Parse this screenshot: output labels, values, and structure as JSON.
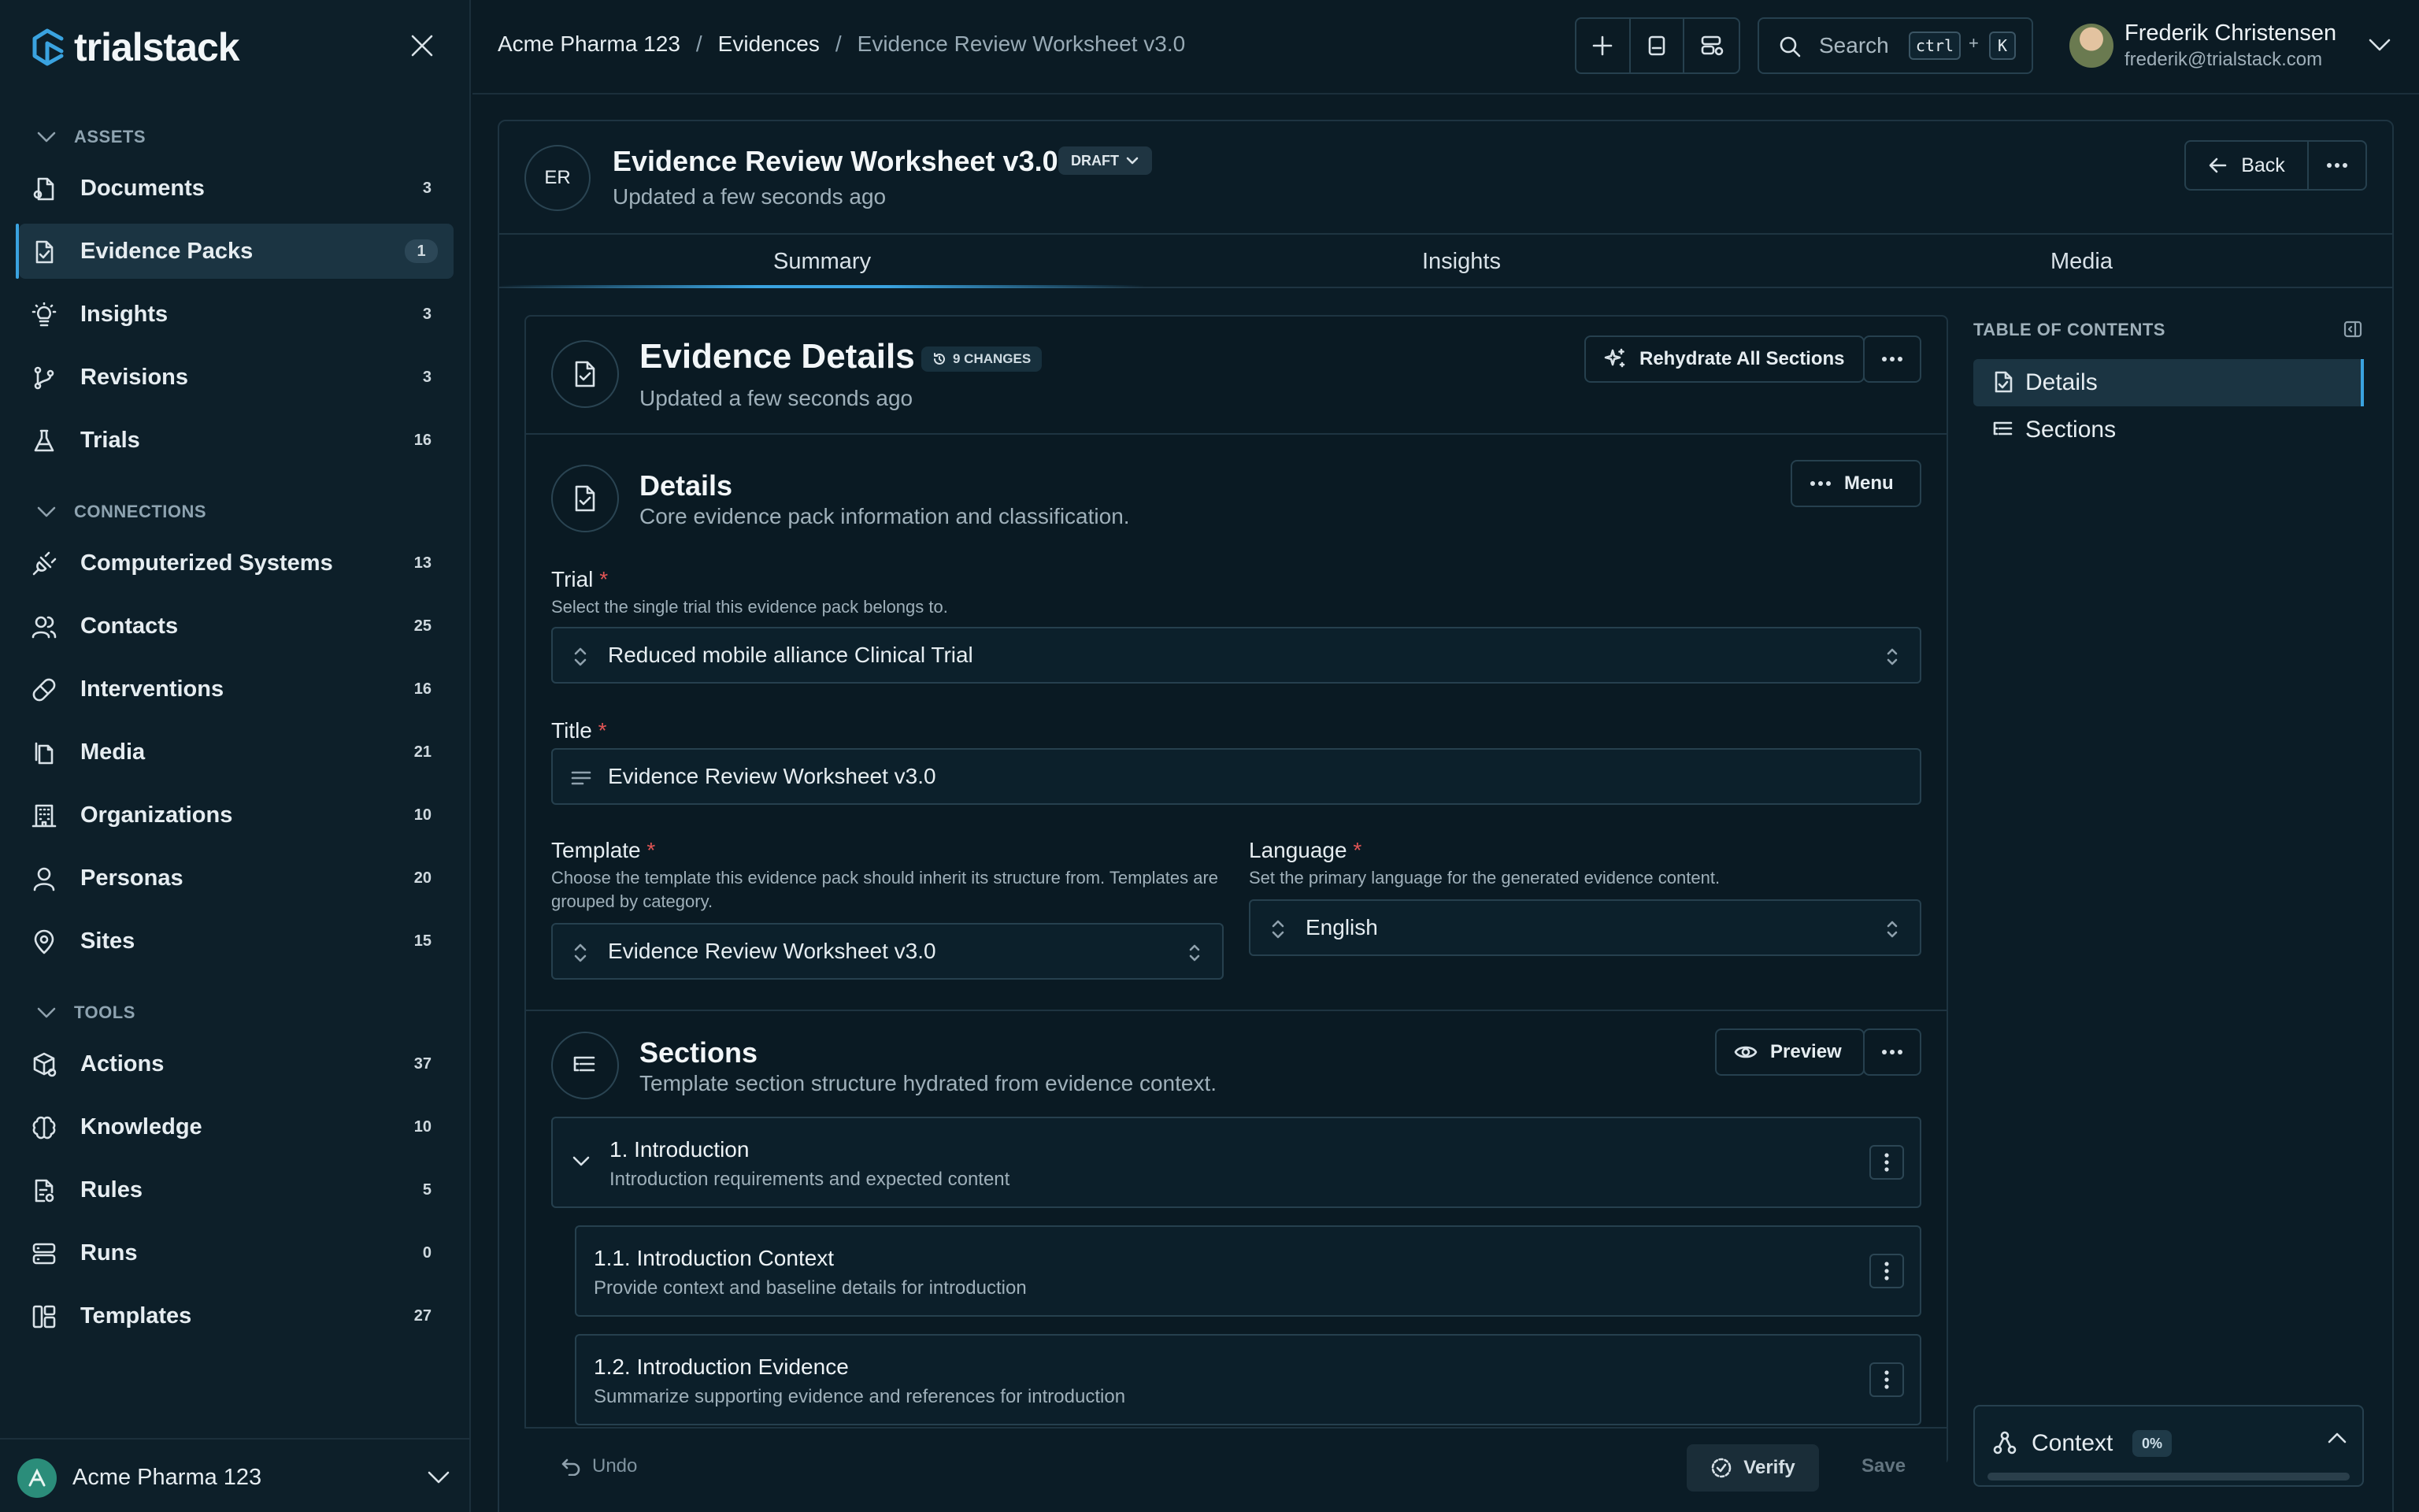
{
  "app": {
    "name": "trialstack"
  },
  "sidebar": {
    "groups": [
      {
        "title": "ASSETS",
        "items": [
          {
            "label": "Documents",
            "count": "3",
            "icon": "document-icon"
          },
          {
            "label": "Evidence Packs",
            "count": "1",
            "icon": "evidence-pack-icon",
            "active": true
          },
          {
            "label": "Insights",
            "count": "3",
            "icon": "lightbulb-icon"
          },
          {
            "label": "Revisions",
            "count": "3",
            "icon": "git-branch-icon"
          },
          {
            "label": "Trials",
            "count": "16",
            "icon": "flask-icon"
          }
        ]
      },
      {
        "title": "CONNECTIONS",
        "items": [
          {
            "label": "Computerized Systems",
            "count": "13",
            "icon": "plug-icon"
          },
          {
            "label": "Contacts",
            "count": "25",
            "icon": "users-icon"
          },
          {
            "label": "Interventions",
            "count": "16",
            "icon": "pill-icon"
          },
          {
            "label": "Media",
            "count": "21",
            "icon": "media-icon"
          },
          {
            "label": "Organizations",
            "count": "10",
            "icon": "building-icon"
          },
          {
            "label": "Personas",
            "count": "20",
            "icon": "user-icon"
          },
          {
            "label": "Sites",
            "count": "15",
            "icon": "map-pin-icon"
          }
        ]
      },
      {
        "title": "TOOLS",
        "items": [
          {
            "label": "Actions",
            "count": "37",
            "icon": "package-icon"
          },
          {
            "label": "Knowledge",
            "count": "10",
            "icon": "brain-icon"
          },
          {
            "label": "Rules",
            "count": "5",
            "icon": "rules-icon"
          },
          {
            "label": "Runs",
            "count": "0",
            "icon": "server-icon"
          },
          {
            "label": "Templates",
            "count": "27",
            "icon": "layout-icon"
          }
        ]
      }
    ],
    "org": {
      "name": "Acme Pharma 123"
    }
  },
  "topbar": {
    "breadcrumb": [
      "Acme Pharma 123",
      "/",
      "Evidences",
      "/",
      "Evidence Review Worksheet v3.0"
    ],
    "search": {
      "label": "Search",
      "kbd1": "ctrl",
      "plus": "+",
      "kbd2": "K"
    },
    "user": {
      "name": "Frederik Christensen",
      "email": "frederik@trialstack.com"
    }
  },
  "document": {
    "avatar": "ER",
    "title": "Evidence Review Worksheet v3.0",
    "status": "DRAFT",
    "updated": "Updated a few seconds ago",
    "back_label": "Back"
  },
  "tabs": [
    "Summary",
    "Insights",
    "Media"
  ],
  "evidence": {
    "title": "Evidence Details",
    "changes": "9 CHANGES",
    "updated": "Updated a few seconds ago",
    "rehydrate_label": "Rehydrate All Sections"
  },
  "details": {
    "title": "Details",
    "subtitle": "Core evidence pack information and classification.",
    "menu_label": "Menu",
    "trial": {
      "label": "Trial",
      "required": "*",
      "help": "Select the single trial this evidence pack belongs to.",
      "value": "Reduced mobile alliance Clinical Trial"
    },
    "title_field": {
      "label": "Title",
      "required": "*",
      "value": "Evidence Review Worksheet v3.0"
    },
    "template": {
      "label": "Template",
      "required": "*",
      "help": "Choose the template this evidence pack should inherit its structure from. Templates are grouped by category.",
      "value": "Evidence Review Worksheet v3.0"
    },
    "language": {
      "label": "Language",
      "required": "*",
      "help": "Set the primary language for the generated evidence content.",
      "value": "English"
    }
  },
  "sections": {
    "title": "Sections",
    "subtitle": "Template section structure hydrated from evidence context.",
    "preview_label": "Preview",
    "items": [
      {
        "title": "1. Introduction",
        "desc": "Introduction requirements and expected content"
      },
      {
        "title": "1.1. Introduction Context",
        "desc": "Provide context and baseline details for introduction"
      },
      {
        "title": "1.2. Introduction Evidence",
        "desc": "Summarize supporting evidence and references for introduction"
      }
    ]
  },
  "footer": {
    "undo": "Undo",
    "verify": "Verify",
    "save": "Save"
  },
  "toc": {
    "title": "TABLE OF CONTENTS",
    "items": [
      "Details",
      "Sections"
    ]
  },
  "context": {
    "label": "Context",
    "percent": "0%",
    "progress": 0
  },
  "colors": {
    "accent": "#3aa3e0",
    "background": "#0b1b24",
    "required": "#e05555"
  }
}
